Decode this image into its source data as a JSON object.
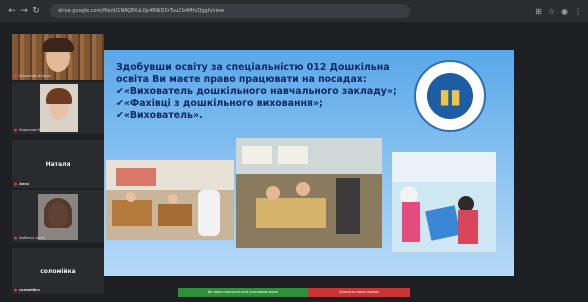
{
  "browser": {
    "url": "drive.google.com/file/d/1NfKJ8XsL0p4RWDXrTuuCb4Mh/Qggh/view"
  },
  "participants": [
    {
      "name": "Кирянова Жанна"
    },
    {
      "name": "Кирянова Юлія"
    },
    {
      "name": "Наталя",
      "caption": "Анна"
    },
    {
      "name": "Бабенко Анна"
    },
    {
      "name": "соломійка",
      "caption": "соломійка"
    }
  ],
  "slide": {
    "intro": "Здобувши освіту за спеціальністю 012 Дошкільна освіта Ви маєте право працювати на посадах:",
    "items": [
      "✔«Вихователь дошкільного навчального закладу»;",
      "✔«Фахівці з дошкільного виховання»;",
      "✔«Вихователь»."
    ]
  },
  "bottom_bar": {
    "share_label": "Ви зараз показуєте всім учасникам екран",
    "stop_label": "Зупинити показ екрана"
  },
  "colors": {
    "accent_green": "#2f8f3b",
    "accent_red": "#c93434",
    "slide_text": "#0b2a66"
  }
}
